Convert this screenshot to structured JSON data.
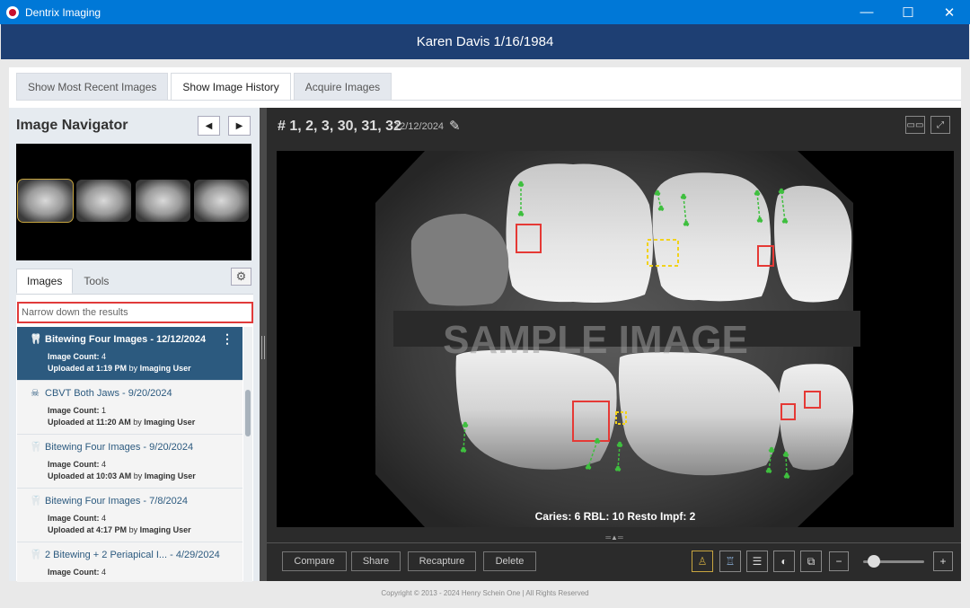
{
  "window": {
    "title": "Dentrix Imaging",
    "controls": {
      "minimize": "—",
      "maximize": "☐",
      "close": "✕"
    }
  },
  "patient": {
    "header": "Karen Davis 1/16/1984"
  },
  "main_tabs": [
    {
      "label": "Show Most Recent Images",
      "active": false
    },
    {
      "label": "Show Image History",
      "active": true
    },
    {
      "label": "Acquire Images",
      "active": false
    }
  ],
  "navigator": {
    "title": "Image Navigator",
    "prev_icon": "◀",
    "next_icon": "▶",
    "thumbnail_count": 4,
    "selected_thumbnail": 1
  },
  "sub_tabs": [
    {
      "label": "Images",
      "active": true
    },
    {
      "label": "Tools",
      "active": false
    }
  ],
  "settings_icon": "⚙",
  "search": {
    "placeholder": "Narrow down the results"
  },
  "image_list": [
    {
      "icon": "tooth-icon",
      "glyph": "🦷",
      "title": "Bitewing Four Images - 12/12/2024",
      "count_label": "Image Count:",
      "count": "4",
      "uploaded_label": "Uploaded at",
      "time": "1:19 PM",
      "by_label": "by",
      "user": "Imaging User",
      "selected": true
    },
    {
      "icon": "skull-icon",
      "glyph": "☠",
      "title": "CBVT Both Jaws - 9/20/2024",
      "count_label": "Image Count:",
      "count": "1",
      "uploaded_label": "Uploaded at",
      "time": "11:20 AM",
      "by_label": "by",
      "user": "Imaging User",
      "selected": false
    },
    {
      "icon": "tooth-icon",
      "glyph": "🦷",
      "title": "Bitewing Four Images - 9/20/2024",
      "count_label": "Image Count:",
      "count": "4",
      "uploaded_label": "Uploaded at",
      "time": "10:03 AM",
      "by_label": "by",
      "user": "Imaging User",
      "selected": false
    },
    {
      "icon": "tooth-icon",
      "glyph": "🦷",
      "title": "Bitewing Four Images - 7/8/2024",
      "count_label": "Image Count:",
      "count": "4",
      "uploaded_label": "Uploaded at",
      "time": "4:17 PM",
      "by_label": "by",
      "user": "Imaging User",
      "selected": false
    },
    {
      "icon": "tooth-icon",
      "glyph": "🦷",
      "title": "2 Bitewing + 2 Periapical I...   - 4/29/2024",
      "count_label": "Image Count:",
      "count": "4",
      "uploaded_label": "",
      "time": "",
      "by_label": "",
      "user": "",
      "selected": false
    }
  ],
  "viewer": {
    "teeth": "# 1, 2, 3, 30, 31, 32",
    "date": "12/12/2024",
    "edit_icon": "✎",
    "watermark": "SAMPLE IMAGE",
    "findings": "Caries: 6 RBL: 10 Resto Impf: 2",
    "grip": "═▲═",
    "compare_icon": "▭▭",
    "fullscreen_icon": "⤢"
  },
  "toolbar": {
    "compare": "Compare",
    "share": "Share",
    "recapture": "Recapture",
    "delete": "Delete",
    "zoom_out": "−",
    "zoom_in": "+",
    "zoom_level": 0.2
  },
  "footer": {
    "copyright": "Copyright © 2013 - 2024 Henry Schein One | All Rights Reserved"
  }
}
